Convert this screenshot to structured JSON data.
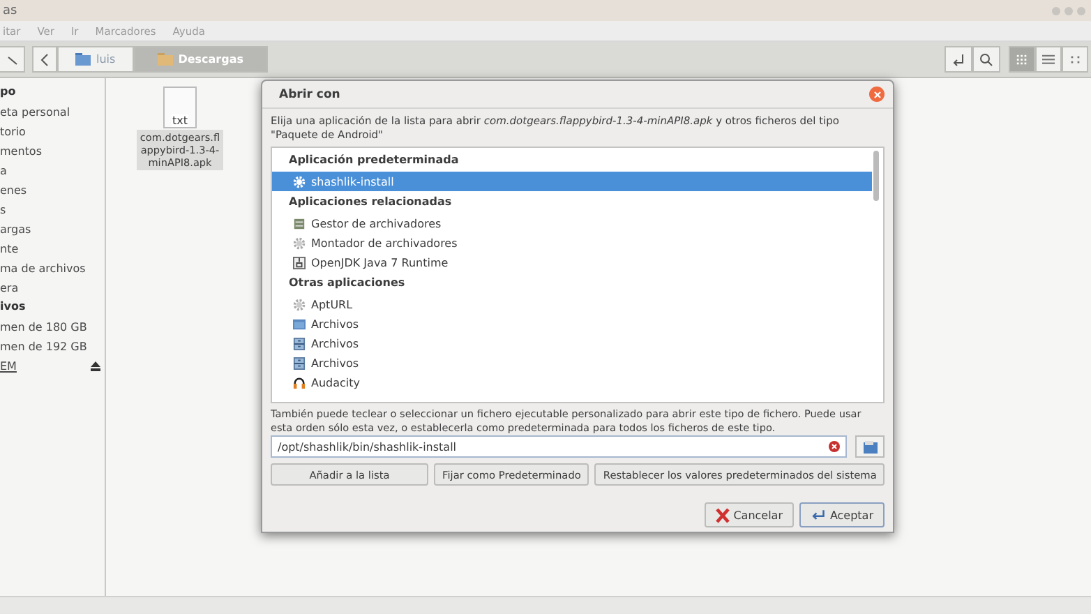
{
  "window": {
    "title": "as"
  },
  "menu": [
    "itar",
    "Ver",
    "Ir",
    "Marcadores",
    "Ayuda"
  ],
  "path": [
    {
      "label": "luis",
      "selected": false
    },
    {
      "label": "Descargas",
      "selected": true
    }
  ],
  "view_buttons": [
    {
      "selected": true
    },
    {
      "selected": false
    },
    {
      "selected": false
    }
  ],
  "sidebar": {
    "items": [
      {
        "kind": "header",
        "label": "po"
      },
      {
        "kind": "item",
        "label": "eta personal"
      },
      {
        "kind": "item",
        "label": "torio"
      },
      {
        "kind": "item",
        "label": "mentos"
      },
      {
        "kind": "item",
        "label": "a"
      },
      {
        "kind": "item",
        "label": "enes"
      },
      {
        "kind": "item",
        "label": "s"
      },
      {
        "kind": "item",
        "label": "argas"
      },
      {
        "kind": "item",
        "label": "nte"
      },
      {
        "kind": "item",
        "label": "ma de archivos"
      },
      {
        "kind": "item",
        "label": "era"
      },
      {
        "kind": "header",
        "label": "ivos"
      },
      {
        "kind": "item",
        "label": "men de 180 GB"
      },
      {
        "kind": "item",
        "label": "men de 192 GB"
      },
      {
        "kind": "eject",
        "label": "EM"
      }
    ]
  },
  "files": [
    {
      "icon_label": "txt",
      "name": "com.dotgears.flappybird-1.3-4-minAPI8.apk",
      "selected": true
    }
  ],
  "dialog": {
    "title": "Abrir con",
    "description": "Elija una aplicación de la lista para abrir *com.dotgears.flappybird-1.3-4-minAPI8.apk* y otros ficheros del tipo \"Paquete de Android\"",
    "apps": [
      {
        "kind": "header",
        "label": "Aplicación predeterminada"
      },
      {
        "kind": "app",
        "label": "shashlik-install",
        "selected": true
      },
      {
        "kind": "header",
        "label": "Aplicaciones relacionadas"
      },
      {
        "kind": "app",
        "label": "Gestor de archivadores",
        "selected": false
      },
      {
        "kind": "app",
        "label": "Montador de archivadores",
        "selected": false
      },
      {
        "kind": "app",
        "label": "OpenJDK Java 7 Runtime",
        "selected": false
      },
      {
        "kind": "header",
        "label": "Otras aplicaciones"
      },
      {
        "kind": "app",
        "label": "AptURL",
        "selected": false
      },
      {
        "kind": "app",
        "label": "Archivos",
        "selected": false
      },
      {
        "kind": "app",
        "label": "Archivos",
        "selected": false
      },
      {
        "kind": "app",
        "label": "Archivos",
        "selected": false
      },
      {
        "kind": "app",
        "label": "Audacity",
        "selected": false
      }
    ],
    "hint": "También puede teclear o seleccionar un fichero ejecutable personalizado para abrir este tipo de fichero. Puede usar esta orden sólo esta vez, o establecerla como predeterminada para todos los ficheros de este tipo.",
    "command": "/opt/shashlik/bin/shashlik-install",
    "actions": [
      "Añadir a la lista",
      "Fijar como Predeterminado",
      "Restablecer los valores predeterminados del sistema"
    ],
    "cancel": "Cancelar",
    "accept": "Aceptar"
  }
}
